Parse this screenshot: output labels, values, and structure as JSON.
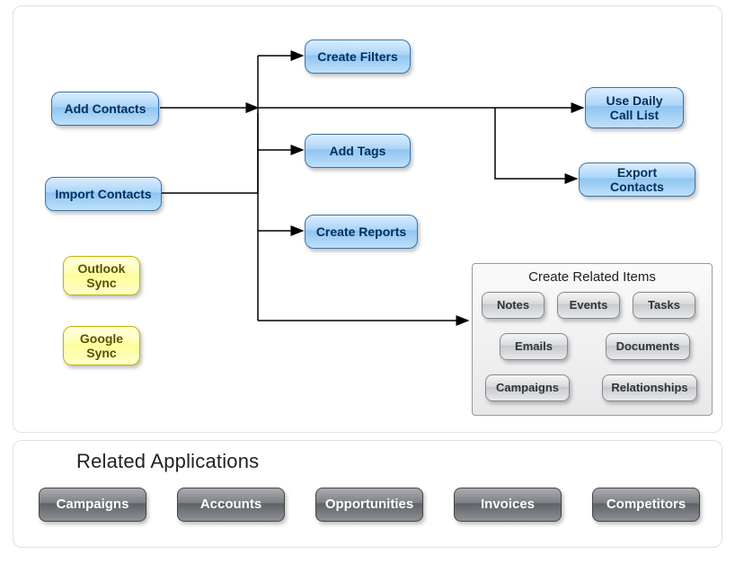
{
  "diagram": {
    "nodes": {
      "add_contacts": "Add Contacts",
      "import_contacts": "Import Contacts",
      "outlook_sync": "Outlook\nSync",
      "google_sync": "Google\nSync",
      "create_filters": "Create Filters",
      "add_tags": "Add Tags",
      "create_reports": "Create Reports",
      "use_daily_call_list": "Use Daily\nCall List",
      "export_contacts": "Export Contacts"
    },
    "related_items": {
      "title": "Create Related Items",
      "items": {
        "notes": "Notes",
        "events": "Events",
        "tasks": "Tasks",
        "emails": "Emails",
        "documents": "Documents",
        "campaigns": "Campaigns",
        "relationships": "Relationships"
      }
    }
  },
  "related_apps": {
    "title": "Related Applications",
    "items": {
      "campaigns": "Campaigns",
      "accounts": "Accounts",
      "opportunities": "Opportunities",
      "invoices": "Invoices",
      "competitors": "Competitors"
    }
  }
}
